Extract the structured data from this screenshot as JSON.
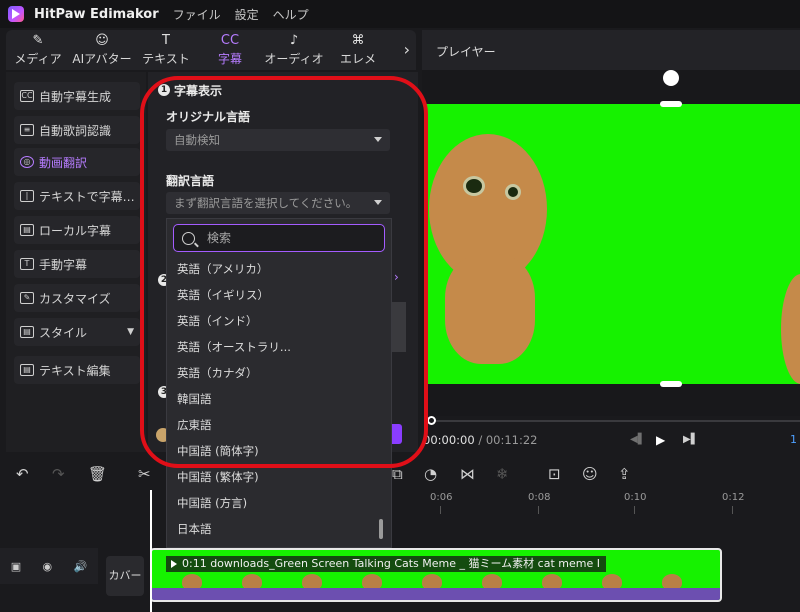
{
  "app": {
    "title": "HitPaw Edimakor",
    "menus": [
      "ファイル",
      "設定",
      "ヘルプ"
    ]
  },
  "categories": [
    {
      "label": "メディア",
      "icon": "✎"
    },
    {
      "label": "AIアバター",
      "icon": "☺"
    },
    {
      "label": "テキスト",
      "icon": "T"
    },
    {
      "label": "字幕",
      "icon": "CC"
    },
    {
      "label": "オーディオ",
      "icon": "♪"
    },
    {
      "label": "エレメ",
      "icon": "⌘"
    }
  ],
  "sidebar": {
    "items": [
      {
        "label": "自動字幕生成",
        "icon": "CC"
      },
      {
        "label": "自動歌詞認識",
        "icon": "≡"
      },
      {
        "label": "動画翻訳",
        "icon": "◎"
      },
      {
        "label": "テキストで字幕…",
        "icon": "|"
      },
      {
        "label": "ローカル字幕",
        "icon": "▤"
      },
      {
        "label": "手動字幕",
        "icon": "T"
      },
      {
        "label": "カスタマイズ",
        "icon": "✎"
      },
      {
        "label": "スタイル",
        "icon": "▤"
      },
      {
        "label": "テキスト編集",
        "icon": "▤"
      }
    ]
  },
  "subtitle_panel": {
    "section1_title": "字幕表示",
    "section1_num": "1",
    "section2_num": "2",
    "section3_num": "3",
    "original_language_label": "オリジナル言語",
    "original_language_value": "自動検知",
    "translate_language_label": "翻訳言語",
    "translate_language_placeholder": "まず翻訳言語を選択してください。"
  },
  "language_dropdown": {
    "search_placeholder": "検索",
    "options": [
      "英語（アメリカ）",
      "英語（イギリス）",
      "英語（インド）",
      "英語（オーストラリ...",
      "英語（カナダ）",
      "韓国語",
      "広東語",
      "中国語 (簡体字)",
      "中国語 (繁体字)",
      "中国語 (方言)",
      "日本語"
    ]
  },
  "player": {
    "title": "プレイヤー",
    "current_time": "00:00:00",
    "total_time": "00:11:22",
    "edge_text": "1"
  },
  "timeline": {
    "ticks": [
      "0:06",
      "0:08",
      "0:10",
      "0:12"
    ],
    "cover_label": "カバー",
    "clip_label": "0:11 downloads_Green Screen Talking Cats Meme _ 猫ミーム素材 cat meme I"
  },
  "colors": {
    "accent": "#b67cff",
    "annotation": "#e00f18",
    "green_screen": "#16f200"
  }
}
